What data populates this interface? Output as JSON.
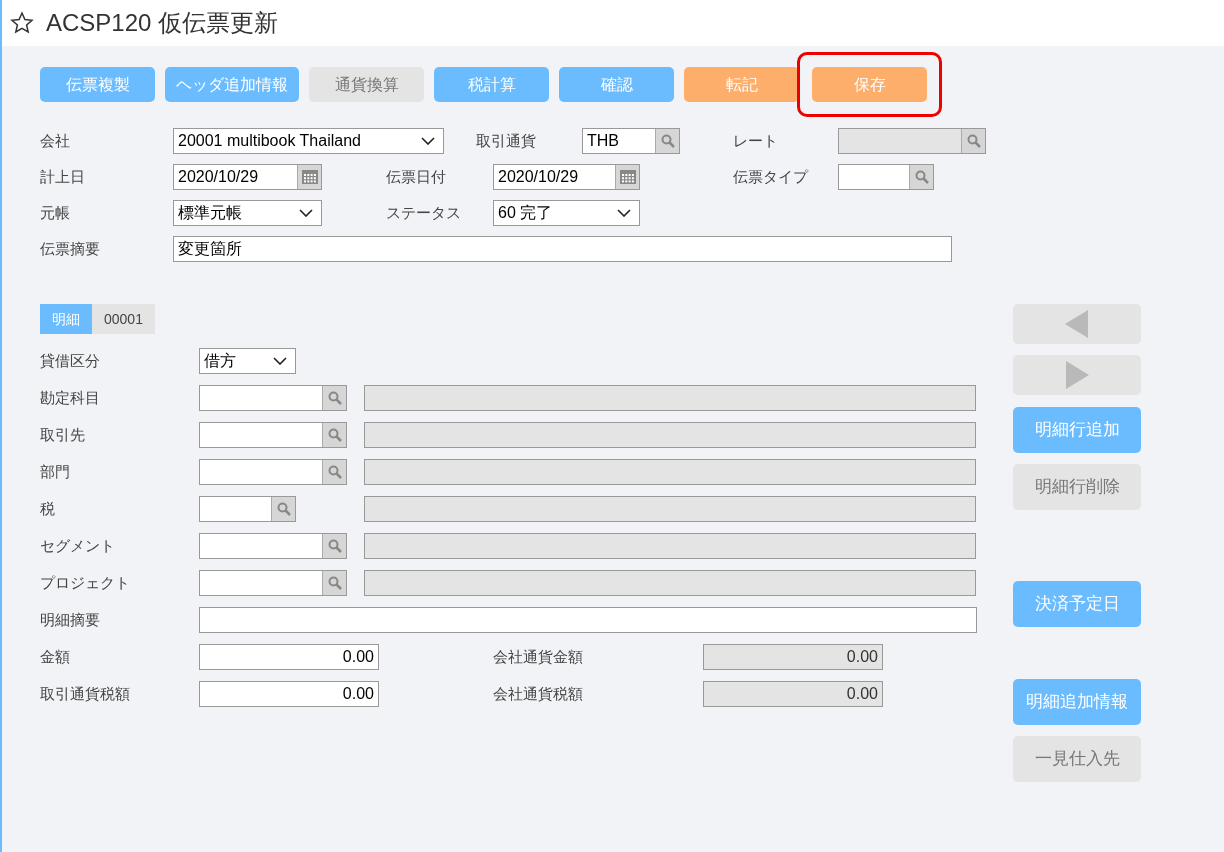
{
  "title": "ACSP120 仮伝票更新",
  "toolbar": [
    {
      "label": "伝票複製",
      "kind": "primary",
      "highlighted": false
    },
    {
      "label": "ヘッダ追加情報",
      "kind": "primary",
      "highlighted": false
    },
    {
      "label": "通貨換算",
      "kind": "disabled",
      "highlighted": false
    },
    {
      "label": "税計算",
      "kind": "primary",
      "highlighted": false
    },
    {
      "label": "確認",
      "kind": "primary",
      "highlighted": false
    },
    {
      "label": "転記",
      "kind": "accent",
      "highlighted": false
    },
    {
      "label": "保存",
      "kind": "accent",
      "highlighted": true
    }
  ],
  "header_rows": [
    [
      {
        "label": "会社",
        "kind": "select",
        "value": "20001 multibook Thailand"
      },
      {
        "label": "取引通貨",
        "kind": "lookup",
        "value": "THB",
        "disabled": false
      },
      {
        "label": "レート",
        "kind": "lookup",
        "disabled": true
      }
    ],
    [
      {
        "label": "計上日",
        "kind": "date",
        "value": "2020/10/29"
      },
      {
        "label": "伝票日付",
        "kind": "date",
        "value": "2020/10/29"
      },
      {
        "label": "伝票タイプ",
        "kind": "lookup",
        "disabled": false
      }
    ],
    [
      {
        "label": "元帳",
        "kind": "select",
        "value": "標準元帳"
      },
      {
        "label": "ステータス",
        "kind": "select",
        "value": "60 完了"
      }
    ],
    [
      {
        "label": "伝票摘要",
        "kind": "text",
        "value": "変更箇所"
      }
    ]
  ],
  "detail_tabs": [
    {
      "label": "明細",
      "selected": true
    },
    {
      "label": "00001",
      "selected": false
    }
  ],
  "detail_rows": [
    {
      "label": "貸借区分",
      "kind": "select",
      "value": "借方"
    },
    {
      "label": "勘定科目",
      "kind": "lookup"
    },
    {
      "label": "取引先",
      "kind": "lookup"
    },
    {
      "label": "部門",
      "kind": "lookup"
    },
    {
      "label": "税",
      "kind": "lookup_short"
    },
    {
      "label": "セグメント",
      "kind": "lookup"
    },
    {
      "label": "プロジェクト",
      "kind": "lookup"
    },
    {
      "label": "明細摘要",
      "kind": "text"
    },
    {
      "label": "金額",
      "kind": "amount",
      "value": "0.00",
      "company_label": "会社通貨金額",
      "company_value": "0.00"
    },
    {
      "label": "取引通貨税額",
      "kind": "amount",
      "value": "0.00",
      "company_label": "会社通貨税額",
      "company_value": "0.00"
    }
  ],
  "side_buttons": [
    {
      "kind": "prev",
      "disabled": true
    },
    {
      "kind": "next",
      "disabled": true
    },
    {
      "kind": "label",
      "label": "明細行追加",
      "disabled": false
    },
    {
      "kind": "label",
      "label": "明細行削除",
      "disabled": true
    },
    {
      "kind": "label",
      "label": "決済予定日",
      "disabled": false
    },
    {
      "kind": "label",
      "label": "明細追加情報",
      "disabled": false
    },
    {
      "kind": "label",
      "label": "一見仕入先",
      "disabled": true
    }
  ]
}
